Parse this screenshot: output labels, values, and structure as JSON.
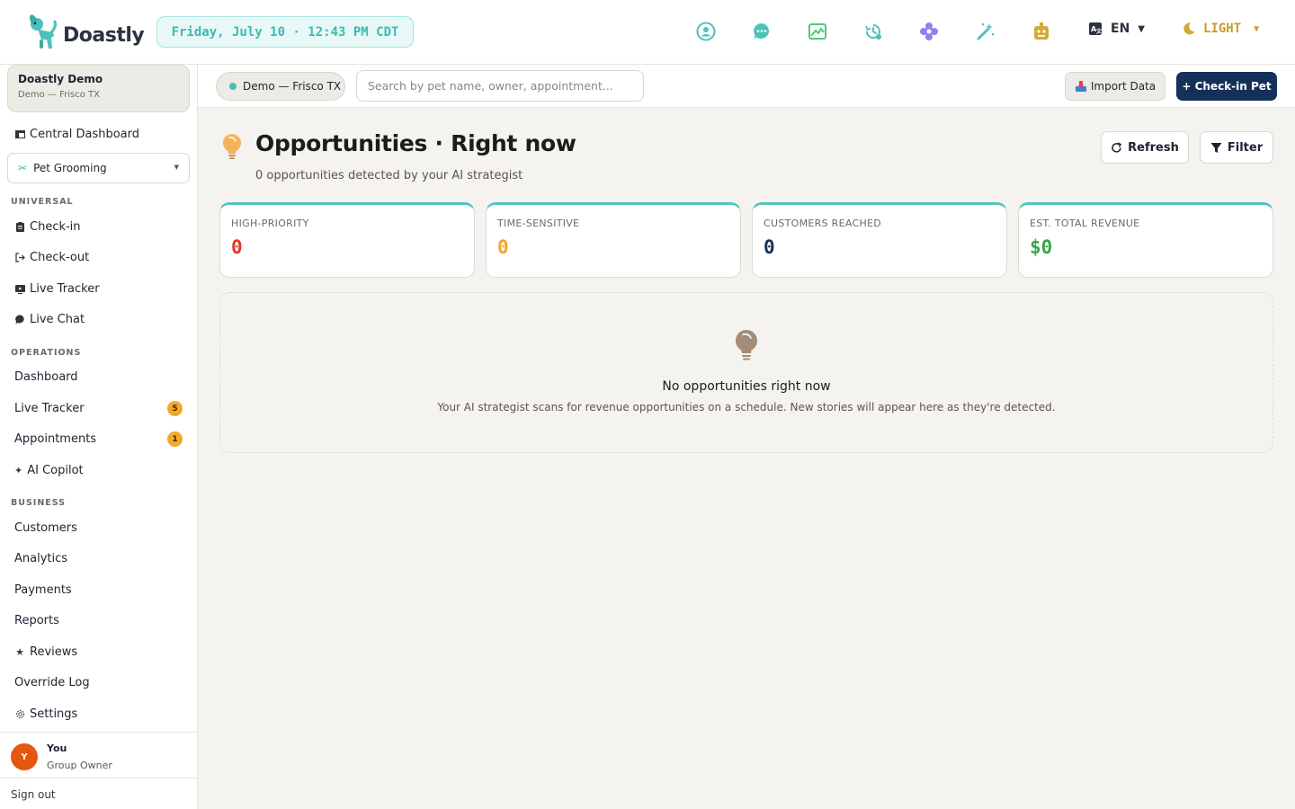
{
  "brand": {
    "name": "Doastly"
  },
  "header": {
    "datetime": "Friday, July 10 · 12:43 PM CDT",
    "language": "EN",
    "theme": "LIGHT",
    "icons": [
      "support-icon",
      "chat-bubble-icon",
      "image-gallery-icon",
      "clock-history-icon",
      "settings-gear-icon",
      "magic-wand-icon",
      "robot-icon"
    ]
  },
  "sidebar": {
    "org": {
      "name": "Doastly Demo",
      "location": "Demo — Frisco TX"
    },
    "central_dashboard": "Central Dashboard",
    "service_select": "Pet Grooming",
    "sections": {
      "universal": "UNIVERSAL",
      "operations": "OPERATIONS",
      "business": "BUSINESS"
    },
    "universal": [
      "Check-in",
      "Check-out",
      "Live Tracker",
      "Live Chat"
    ],
    "operations": [
      {
        "label": "Dashboard",
        "badge": ""
      },
      {
        "label": "Live Tracker",
        "badge": "5"
      },
      {
        "label": "Appointments",
        "badge": "1"
      },
      {
        "label": "AI Copilot",
        "badge": ""
      }
    ],
    "business": [
      "Customers",
      "Analytics",
      "Payments",
      "Reports",
      "Reviews",
      "Override Log",
      "Settings"
    ],
    "user": {
      "initial": "Y",
      "name": "You",
      "role": "Group Owner"
    },
    "sign_out": "Sign out"
  },
  "subheader": {
    "location_pill": "Demo — Frisco TX",
    "search_placeholder": "Search by pet name, owner, appointment...",
    "import_label": "Import Data",
    "checkin_label": "+ Check-in Pet"
  },
  "main": {
    "title": "Opportunities · Right now",
    "subtitle": "0 opportunities detected by your AI strategist",
    "refresh_label": "Refresh",
    "filter_label": "Filter",
    "stats": [
      {
        "label": "HIGH-PRIORITY",
        "value": "0",
        "color": "#e0392b"
      },
      {
        "label": "TIME-SENSITIVE",
        "value": "0",
        "color": "#f3a530"
      },
      {
        "label": "CUSTOMERS REACHED",
        "value": "0",
        "color": "#15315a"
      },
      {
        "label": "EST. TOTAL REVENUE",
        "value": "$0",
        "color": "#3aa64c"
      }
    ],
    "empty_title": "No opportunities right now",
    "empty_desc": "Your AI strategist scans for revenue opportunities on a schedule. New stories will appear here as they're detected."
  },
  "colors": {
    "accent": "#52c4bd",
    "primary": "#15315a",
    "badge": "#f1a92a"
  }
}
